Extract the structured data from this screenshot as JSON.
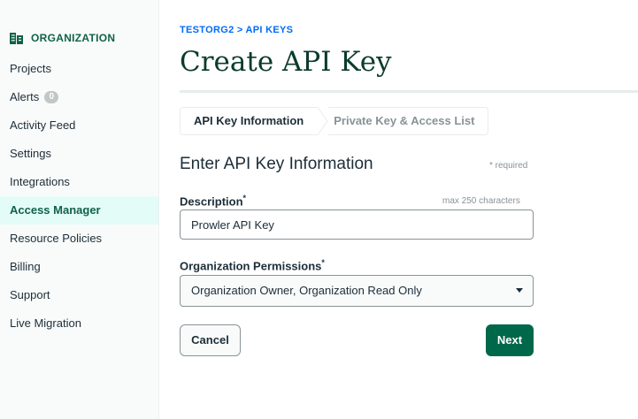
{
  "sidebar": {
    "org_title": "ORGANIZATION",
    "items": [
      {
        "label": "Projects"
      },
      {
        "label": "Alerts",
        "badge": "0"
      },
      {
        "label": "Activity Feed"
      },
      {
        "label": "Settings"
      },
      {
        "label": "Integrations"
      },
      {
        "label": "Access Manager",
        "active": true
      },
      {
        "label": "Resource Policies"
      },
      {
        "label": "Billing"
      },
      {
        "label": "Support"
      },
      {
        "label": "Live Migration"
      }
    ]
  },
  "header": {
    "breadcrumb": "TESTORG2 > API KEYS",
    "title": "Create API Key"
  },
  "stepper": {
    "step1": "API Key Information",
    "step2": "Private Key & Access List"
  },
  "form": {
    "section_title": "Enter API Key Information",
    "required_note": "* required",
    "description": {
      "label": "Description",
      "required_mark": "*",
      "hint": "max 250 characters",
      "value": "Prowler API Key"
    },
    "permissions": {
      "label": "Organization Permissions",
      "required_mark": "*",
      "selected": "Organization Owner, Organization Read Only"
    },
    "cancel_label": "Cancel",
    "next_label": "Next"
  },
  "colors": {
    "brand_green": "#00684a",
    "active_bg": "#e3fcf7",
    "link_blue": "#016bf8"
  }
}
